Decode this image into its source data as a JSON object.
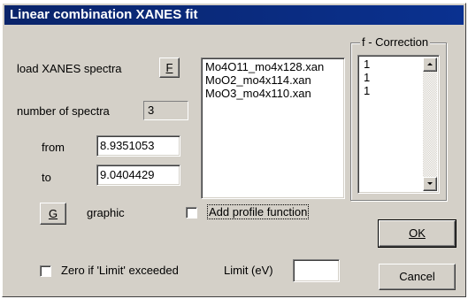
{
  "window": {
    "title": "Linear combination XANES fit"
  },
  "load": {
    "label": "load XANES spectra",
    "button_label": "F"
  },
  "spectra_count": {
    "label": "number of spectra",
    "value": "3"
  },
  "range": {
    "from_label": "from",
    "from_value": "8.9351053",
    "to_label": "to",
    "to_value": "9.0404429"
  },
  "graphic": {
    "button_label": "G",
    "label": "graphic"
  },
  "files": [
    "Mo4O11_mo4x128.xan",
    "MoO2_mo4x114.xan",
    "MoO3_mo4x110.xan"
  ],
  "profile": {
    "label": "Add profile function",
    "checked": false
  },
  "zero_limit": {
    "label": "Zero if 'Limit' exceeded",
    "checked": false,
    "limit_label": "Limit (eV)",
    "limit_value": ""
  },
  "f_correction": {
    "title": "f - Correction",
    "values": [
      "1",
      "1",
      "1"
    ]
  },
  "buttons": {
    "ok": "OK",
    "cancel": "Cancel"
  },
  "colors": {
    "title_bar": "#0a246a",
    "face": "#d4d0c8"
  }
}
